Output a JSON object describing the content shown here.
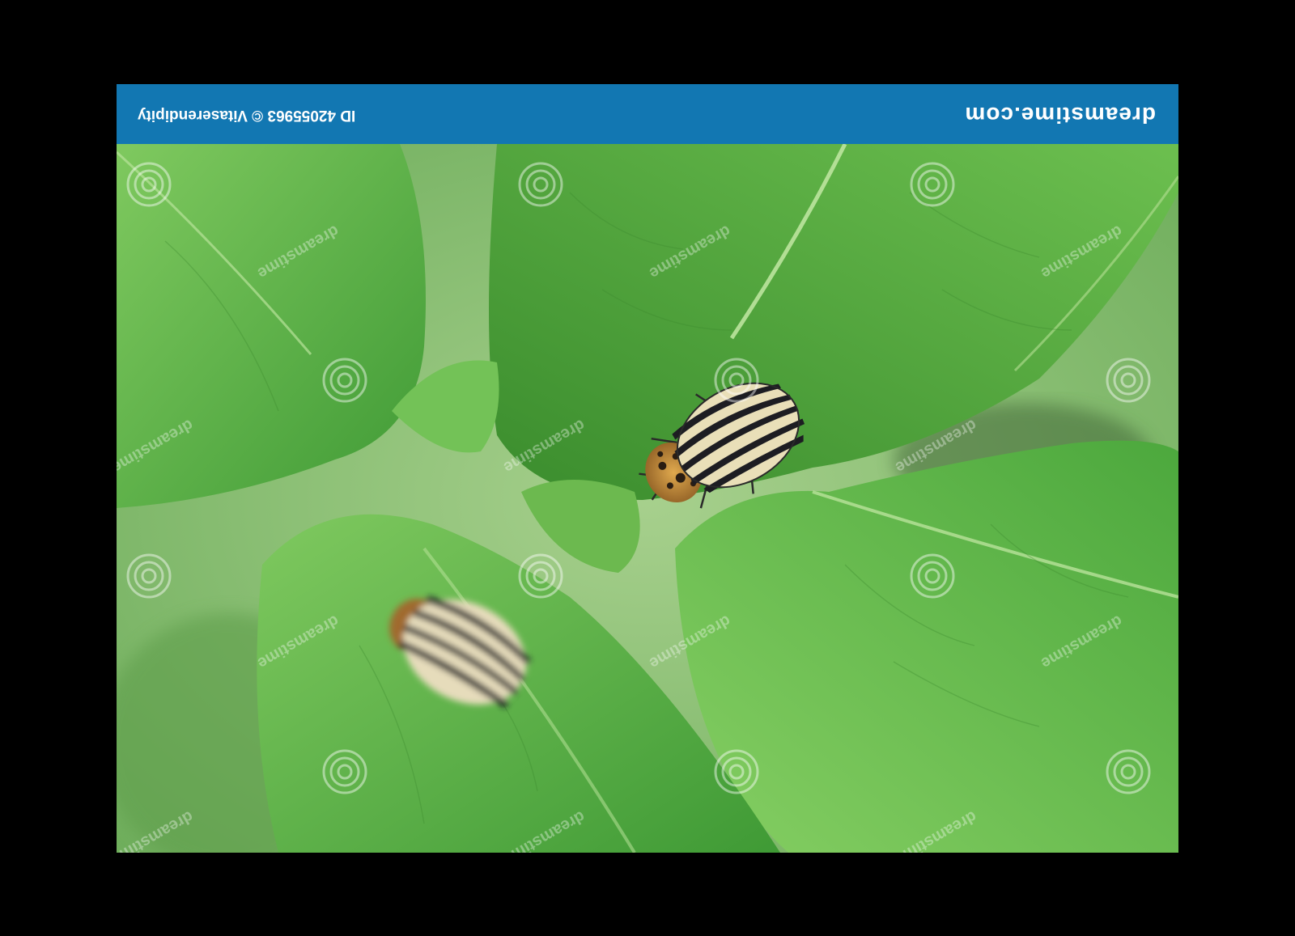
{
  "banner": {
    "brand": "dreamstime.com",
    "credit": "ID 42055963 © Vitaserendipity",
    "color": "#1277b2",
    "orientation": "upside-down"
  },
  "photo": {
    "subject": "two striped beetles on green leaves",
    "watermark": "dreamstime"
  },
  "colors": {
    "leaf": "#63b54a",
    "leaf_dark": "#3f8f2f",
    "background": "#8cc276",
    "beetle_stripe_dark": "#1d1d22",
    "beetle_stripe_light": "#e9dfb8",
    "beetle_head": "#c88a3a"
  }
}
